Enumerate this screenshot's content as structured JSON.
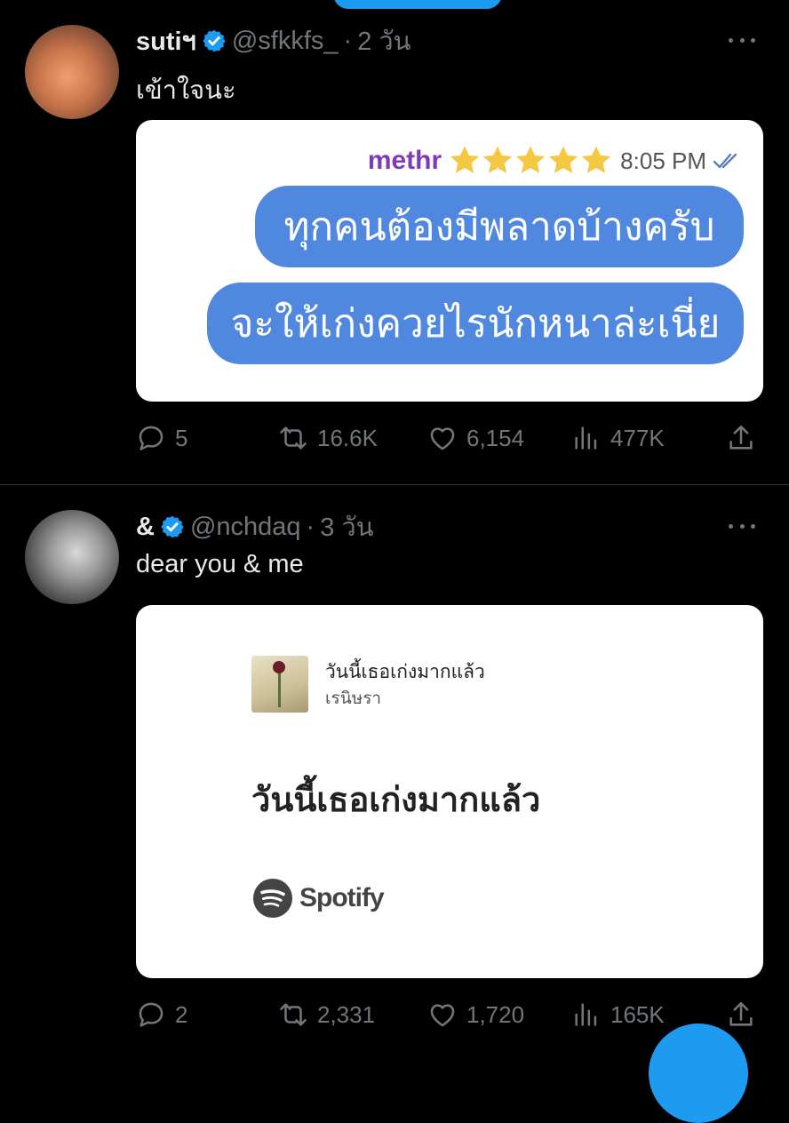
{
  "colors": {
    "accent": "#1d9bf0",
    "muted": "#71767b",
    "bubble": "#5088e0"
  },
  "tweets": [
    {
      "display_name": "sutiฯ",
      "verified": true,
      "handle": "@sfkkfs_",
      "time": "2 วัน",
      "text": "เข้าใจนะ",
      "image": {
        "type": "chat",
        "sender": "methr",
        "stars": 5,
        "time": "8:05 PM",
        "bubbles": [
          "ทุกคนต้องมีพลาดบ้างครับ",
          "จะให้เก่งควยไรนักหนาล่ะเนี่ย"
        ]
      },
      "replies": "5",
      "retweets": "16.6K",
      "likes": "6,154",
      "views": "477K"
    },
    {
      "display_name": "&",
      "verified": true,
      "handle": "@nchdaq",
      "time": "3 วัน",
      "text": "dear you & me",
      "image": {
        "type": "spotify",
        "track_title": "วันนี้เธอเก่งมากแล้ว",
        "artist": "เรนิษรา",
        "big_title": "วันนี้เธอเก่งมากแล้ว",
        "brand": "Spotify"
      },
      "replies": "2",
      "retweets": "2,331",
      "likes": "1,720",
      "views": "165K"
    }
  ]
}
